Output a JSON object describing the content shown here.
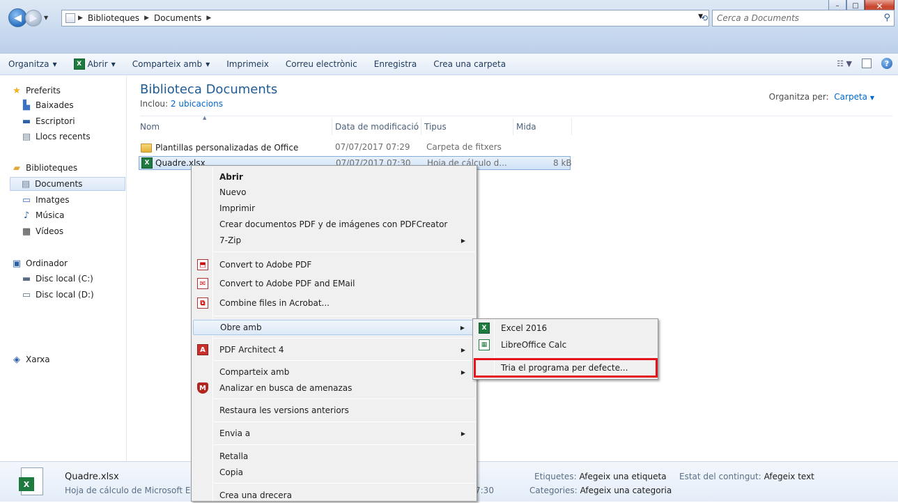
{
  "window": {
    "minimize": "–",
    "maximize": "□",
    "close": "✕"
  },
  "address": {
    "segments": [
      "Biblioteques",
      "Documents"
    ],
    "search_placeholder": "Cerca a Documents"
  },
  "toolbar": {
    "organize": "Organitza",
    "open": "Abrir",
    "share": "Comparteix amb",
    "print": "Imprimeix",
    "email": "Correu electrònic",
    "burn": "Enregistra",
    "new_folder": "Crea una carpeta"
  },
  "nav": {
    "favorites": "Preferits",
    "downloads": "Baixades",
    "desktop": "Escriptori",
    "recent": "Llocs recents",
    "libraries": "Biblioteques",
    "documents": "Documents",
    "images": "Imatges",
    "music": "Música",
    "videos": "Vídeos",
    "computer": "Ordinador",
    "disk_c": "Disc local (C:)",
    "disk_d": "Disc local (D:)",
    "network": "Xarxa"
  },
  "library": {
    "title": "Biblioteca Documents",
    "includes_label": "Inclou:",
    "includes_link": "2 ubicacions",
    "arrange_label": "Organitza per:",
    "arrange_value": "Carpeta"
  },
  "columns": {
    "name": "Nom",
    "modified": "Data de modificació",
    "type": "Tipus",
    "size": "Mida"
  },
  "files": [
    {
      "name": "Plantillas personalizadas de Office",
      "modified": "07/07/2017 07:29",
      "type": "Carpeta de fitxers",
      "size": ""
    },
    {
      "name": "Quadre.xlsx",
      "modified": "07/07/2017 07:30",
      "type": "Hoja de cálculo d...",
      "size": "8 kB"
    }
  ],
  "context_menu": {
    "open": "Abrir",
    "new": "Nuevo",
    "print": "Imprimir",
    "pdfcreator": "Crear documentos PDF y de imágenes con PDFCreator",
    "zip": "7-Zip",
    "to_pdf": "Convert to Adobe PDF",
    "to_pdf_email": "Convert to Adobe PDF and EMail",
    "combine": "Combine files in Acrobat...",
    "open_with": "Obre amb",
    "pdf_architect": "PDF Architect 4",
    "share": "Comparteix amb",
    "scan": "Analizar en busca de amenazas",
    "restore": "Restaura les versions anteriors",
    "send_to": "Envia a",
    "cut": "Retalla",
    "copy": "Copia",
    "shortcut": "Crea una drecera"
  },
  "submenu": {
    "excel": "Excel 2016",
    "calc": "LibreOffice Calc",
    "choose_default": "Tria el programa per defecte..."
  },
  "details": {
    "name": "Quadre.xlsx",
    "type": "Hoja de cálculo de Microsoft Ex",
    "time_fragment": "7:30",
    "tags_label": "Etiquetes:",
    "tags_value": "Afegeix una etiqueta",
    "categories_label": "Categories:",
    "categories_value": "Afegeix una categoria",
    "status_label": "Estat del contingut:",
    "status_value": "Afegeix text"
  },
  "colors": {
    "highlight_box": "#e3121b",
    "title_blue": "#1e5c96",
    "link_blue": "#0066cc"
  }
}
